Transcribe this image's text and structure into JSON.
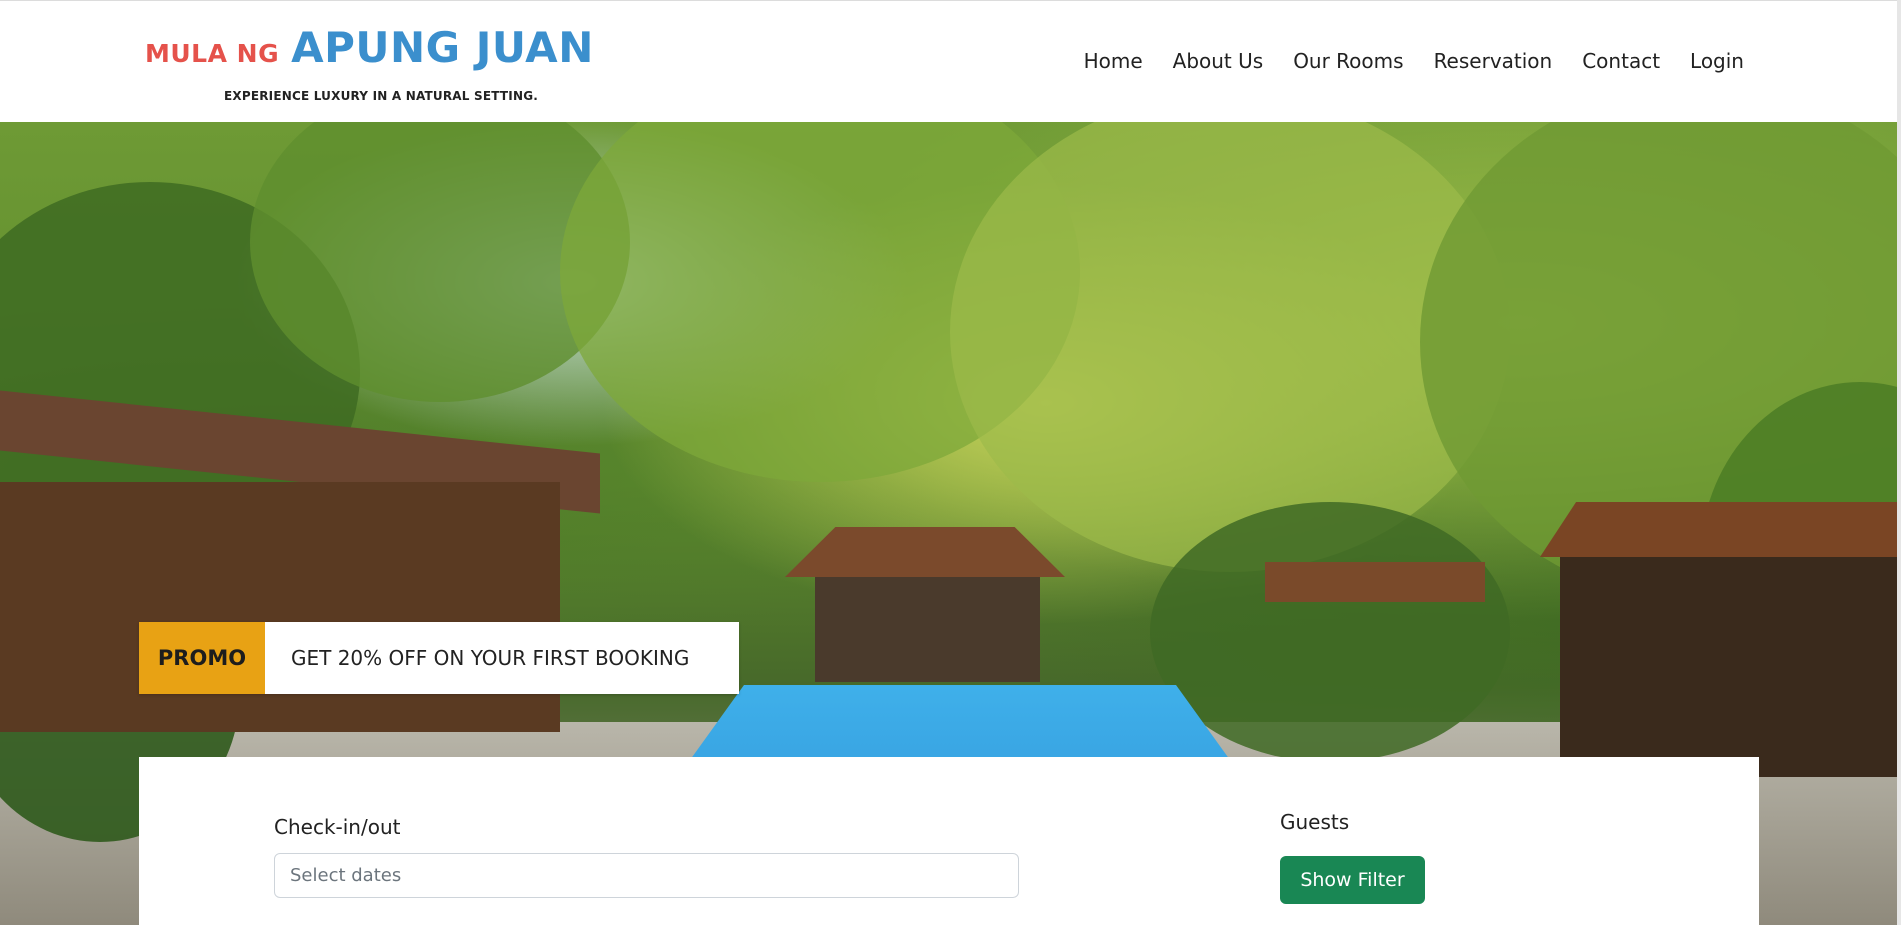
{
  "brand": {
    "name_small": "MULA NG",
    "name_big": "APUNG JUAN",
    "tagline": "EXPERIENCE LUXURY IN A NATURAL SETTING.",
    "colors": {
      "small": "#e5524b",
      "big": "#3b8fcd"
    }
  },
  "nav": {
    "items": [
      {
        "label": "Home"
      },
      {
        "label": "About Us"
      },
      {
        "label": "Our Rooms"
      },
      {
        "label": "Reservation"
      },
      {
        "label": "Contact"
      },
      {
        "label": "Login"
      }
    ]
  },
  "promo": {
    "tag": "PROMO",
    "text": "GET 20% OFF ON YOUR FIRST BOOKING",
    "tag_color": "#e8a214"
  },
  "booking": {
    "checkin_label": "Check-in/out",
    "checkin_placeholder": "Select dates",
    "guests_label": "Guests",
    "filter_button": "Show Filter",
    "button_color": "#198754"
  }
}
